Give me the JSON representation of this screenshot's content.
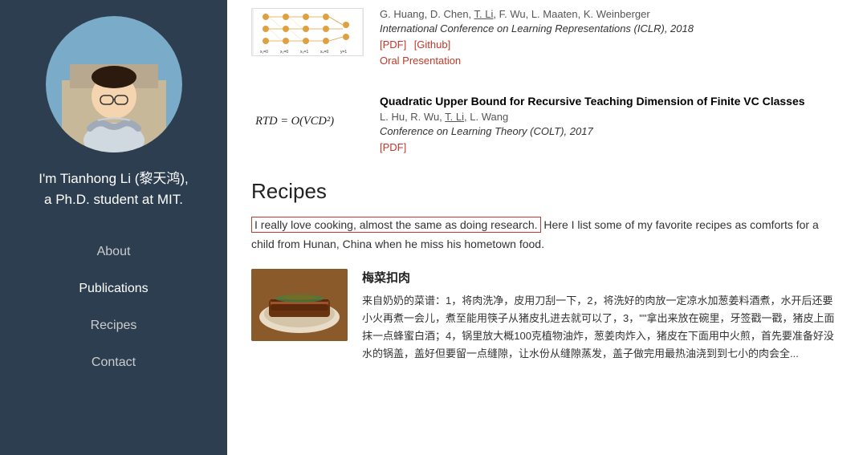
{
  "sidebar": {
    "profile_name_line1": "I'm Tianhong Li (黎天鸿),",
    "profile_name_line2": "a Ph.D. student at MIT.",
    "nav": {
      "about": "About",
      "publications": "Publications",
      "recipes": "Recipes",
      "contact": "Contact"
    }
  },
  "publications": [
    {
      "id": "pub1",
      "has_thumb": true,
      "thumb_type": "graph",
      "authors": "G. Huang, D. Chen, T. Li, F. Wu, L. Maaten, K. Weinberger",
      "author_highlight": "T. Li",
      "venue": "International Conference on Learning Representations (ICLR), 2018",
      "links": [
        "[PDF]",
        "[Github]"
      ],
      "oral": "Oral Presentation",
      "title": ""
    },
    {
      "id": "pub2",
      "has_thumb": true,
      "thumb_type": "equation",
      "thumb_text": "RTD = O(VCD²)",
      "title": "Quadratic Upper Bound for Recursive Teaching Dimension of Finite VC Classes",
      "authors": "L. Hu, R. Wu, T. Li, L. Wang",
      "author_highlight": "T. Li",
      "venue": "Conference on Learning Theory (COLT), 2017",
      "links": [
        "[PDF]"
      ],
      "oral": ""
    }
  ],
  "recipes": {
    "section_title": "Recipes",
    "intro_highlighted": "I really love cooking, almost the same as doing research.",
    "intro_rest": " Here I list some of my favorite recipes as comforts for a child from Hunan, China when he miss his hometown food.",
    "items": [
      {
        "id": "recipe1",
        "title": "梅菜扣肉",
        "description": "来自奶奶的菜谱：1，将肉洗净，皮用刀刮一下，2，将洗好的肉放一定凉水加葱姜料酒煮，水开后还要小火再煮一会儿，煮至能用筷子从猪皮扎进去就可以了，3，\"\"拿出来放在碗里，牙签戳一戳，猪皮上面抹一点蜂蜜白酒；4，锅里放大概100克植物油炸，葱姜肉炸入，猪皮在下面用中火煎，首先要准备好没水的锅盖，盖好但要留一点缝隙，让水份从缝隙蒸发，盖子做完用最热油浇到到七小的肉会全..."
      }
    ]
  }
}
